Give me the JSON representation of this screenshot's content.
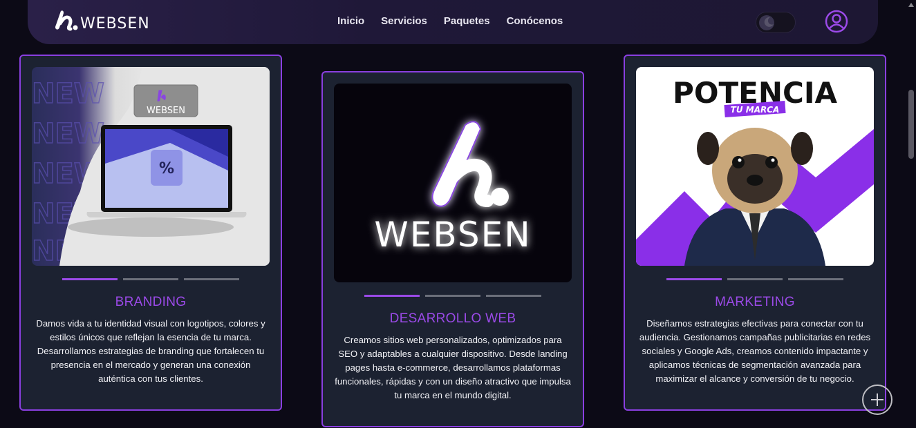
{
  "brand": {
    "name": "WEBSEN"
  },
  "nav": {
    "items": [
      {
        "label": "Inicio"
      },
      {
        "label": "Servicios"
      },
      {
        "label": "Paquetes"
      },
      {
        "label": "Conócenos"
      }
    ]
  },
  "theme_toggle": {
    "state": "dark",
    "icon": "moon-icon"
  },
  "user_icon": "user-circle-icon",
  "colors": {
    "accent": "#9b4ae8",
    "card_bg": "#1c2231",
    "page_bg": "#0c0a16"
  },
  "cards": [
    {
      "title": "BRANDING",
      "text": "Damos vida a tu identidad visual con logotipos, colores y estilos únicos que reflejan la esencia de tu marca. Desarrollamos estrategias de branding que fortalecen tu presencia en el mercado y generan una conexión auténtica con tus clientes.",
      "image": {
        "overlay_text": "NEW",
        "logo_text": "WEBSEN"
      },
      "carousel": {
        "slides": 3,
        "active": 1
      }
    },
    {
      "title": "DESARROLLO WEB",
      "text": "Creamos sitios web personalizados, optimizados para SEO y adaptables a cualquier dispositivo. Desde landing pages hasta e-commerce, desarrollamos plataformas funcionales, rápidas y con un diseño atractivo que impulsa tu marca en el mundo digital.",
      "image": {
        "logo_text": "WEBSEN"
      },
      "carousel": {
        "slides": 3,
        "active": 1
      }
    },
    {
      "title": "MARKETING",
      "text": "Diseñamos estrategias efectivas para conectar con tu audiencia. Gestionamos campañas publicitarias en redes sociales y Google Ads, creamos contenido impactante y aplicamos técnicas de segmentación avanzada para maximizar el alcance y conversión de tu negocio.",
      "image": {
        "headline": "POTENCIA",
        "tag": "TU MARCA"
      },
      "carousel": {
        "slides": 3,
        "active": 1
      }
    }
  ]
}
